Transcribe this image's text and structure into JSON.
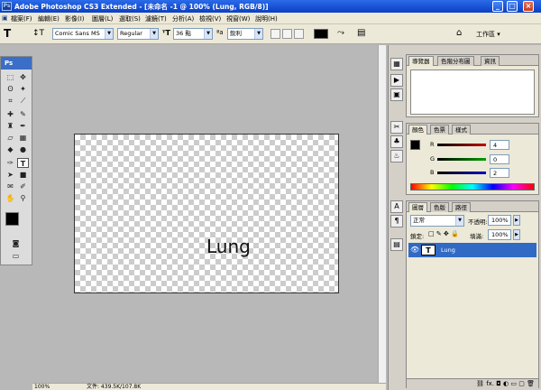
{
  "window": {
    "app_icon": "Ps",
    "title": "Adobe Photoshop CS3 Extended - [未命名 -1 @ 100% (Lung, RGB/8)]",
    "minimize": "_",
    "maximize": "□",
    "close": "×"
  },
  "menu": [
    "檔案(F)",
    "編輯(E)",
    "影像(I)",
    "圖層(L)",
    "選取(S)",
    "濾鏡(T)",
    "分析(A)",
    "檢視(V)",
    "視窗(W)",
    "說明(H)"
  ],
  "options": {
    "tool_glyph": "T",
    "font_family": "Comic Sans MS",
    "font_style": "Regular",
    "font_size": "36 點",
    "antialias": "銳利",
    "workspace": "工作區"
  },
  "toolbox": {
    "header": "Ps"
  },
  "document": {
    "layer_text": "Lung"
  },
  "status": {
    "zoom": "100%",
    "doc_info": "文件: 439.5K/107.8K"
  },
  "navigator": {
    "tabs": [
      "導覽器",
      "色階分布圖",
      "資訊"
    ]
  },
  "color_panel": {
    "tabs": [
      "顏色",
      "色票",
      "樣式"
    ],
    "r_label": "R",
    "g_label": "G",
    "b_label": "B",
    "r_value": "4",
    "g_value": "0",
    "b_value": "2",
    "r_color": "#c00000",
    "g_color": "#00a000",
    "b_color": "#0000c0"
  },
  "layers_panel": {
    "tabs": [
      "圖層",
      "色版",
      "路徑"
    ],
    "blend_mode": "正常",
    "opacity_label": "不透明:",
    "opacity_value": "100%",
    "lock_label": "鎖定:",
    "fill_label": "填滿:",
    "fill_value": "100%",
    "layer_name": "Lung",
    "layer_thumb": "T",
    "selected_color": "#316ac5"
  }
}
